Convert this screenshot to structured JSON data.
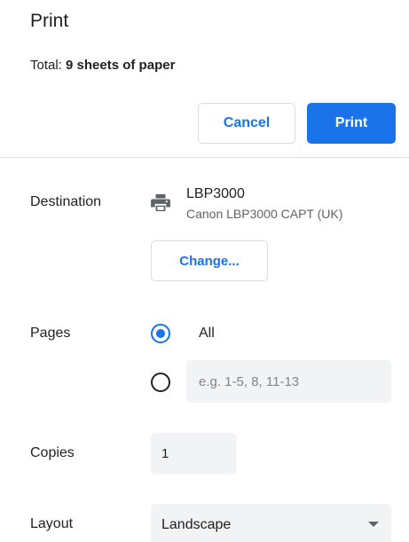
{
  "header": {
    "title": "Print",
    "total_prefix": "Total: ",
    "total_value": "9 sheets of paper"
  },
  "actions": {
    "cancel_label": "Cancel",
    "print_label": "Print"
  },
  "destination": {
    "label": "Destination",
    "printer_icon": "printer-icon",
    "printer_name": "LBP3000",
    "printer_description": "Canon LBP3000 CAPT (UK)",
    "change_label": "Change..."
  },
  "pages": {
    "label": "Pages",
    "options": [
      "All",
      "Custom"
    ],
    "selected": "All",
    "all_label": "All",
    "custom_placeholder": "e.g. 1-5, 8, 11-13",
    "custom_value": ""
  },
  "copies": {
    "label": "Copies",
    "value": "1"
  },
  "layout": {
    "label": "Layout",
    "selected": "Landscape"
  },
  "colors": {
    "accent": "#1a73e8",
    "text": "#202124",
    "field_bg": "#f1f3f4"
  }
}
